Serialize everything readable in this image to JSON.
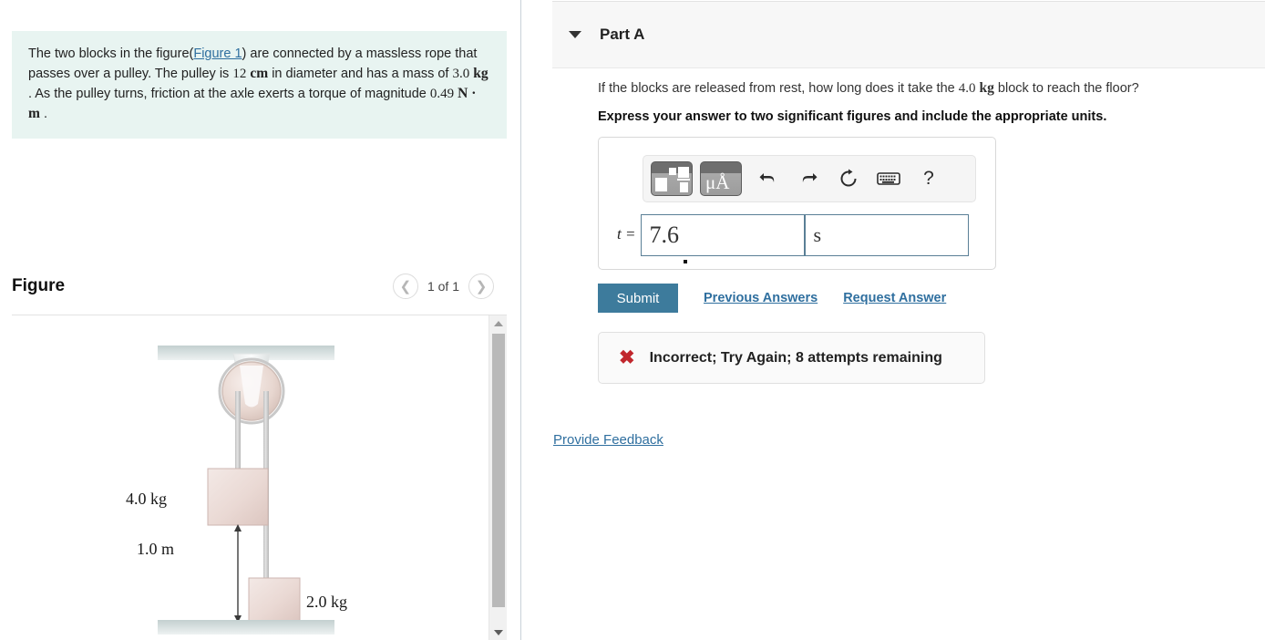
{
  "problem": {
    "text_part1": "The two blocks in the figure(",
    "figure_link": "Figure 1",
    "text_part2": ") are connected by a massless rope that passes over a pulley. The pulley is ",
    "diameter_value": "12",
    "diameter_unit": "cm",
    "text_part3": " in diameter and has a mass of ",
    "mass_value": "3.0",
    "mass_unit": "kg",
    "text_part4": " . As the pulley turns, friction at the axle exerts a torque of magnitude ",
    "torque_value": "0.49",
    "torque_unit": "N · m",
    "text_part5": " ."
  },
  "figure": {
    "title": "Figure",
    "pager_label": "1 of 1",
    "prev_icon": "chevron-left-icon",
    "next_icon": "chevron-right-icon",
    "diagram": {
      "block1_label": "4.0 kg",
      "block2_label": "2.0 kg",
      "distance_label": "1.0 m"
    },
    "scrollbar": {
      "up_icon": "triangle-up-icon",
      "down_icon": "triangle-down-icon"
    }
  },
  "part": {
    "title": "Part A",
    "caret_icon": "caret-down-icon",
    "question": "If the blocks are released from rest, how long does it take the 4.0 kg block to reach the floor?",
    "question_value": "4.0",
    "question_unit": "kg",
    "instruction": "Express your answer to two significant figures and include the appropriate units."
  },
  "answer": {
    "toolbar": {
      "template_button": "math-template-icon",
      "units_button": "μÅ",
      "undo_icon": "undo-icon",
      "redo_icon": "redo-icon",
      "reset_icon": "reset-icon",
      "keyboard_icon": "keyboard-icon",
      "help_icon": "?"
    },
    "label": "t =",
    "value": "7.6",
    "unit_value": "s",
    "value_placeholder": "",
    "unit_placeholder": ""
  },
  "actions": {
    "submit_label": "Submit",
    "previous_answers_label": "Previous Answers",
    "request_answer_label": "Request Answer"
  },
  "feedback": {
    "icon": "x-mark-icon",
    "message": "Incorrect; Try Again; 8 attempts remaining",
    "provide_feedback_label": "Provide Feedback"
  },
  "colors": {
    "accent_blue": "#3d7b9c",
    "link_blue": "#2f6f9f",
    "problem_bg": "#e8f4f1",
    "error_red": "#c1272d"
  }
}
